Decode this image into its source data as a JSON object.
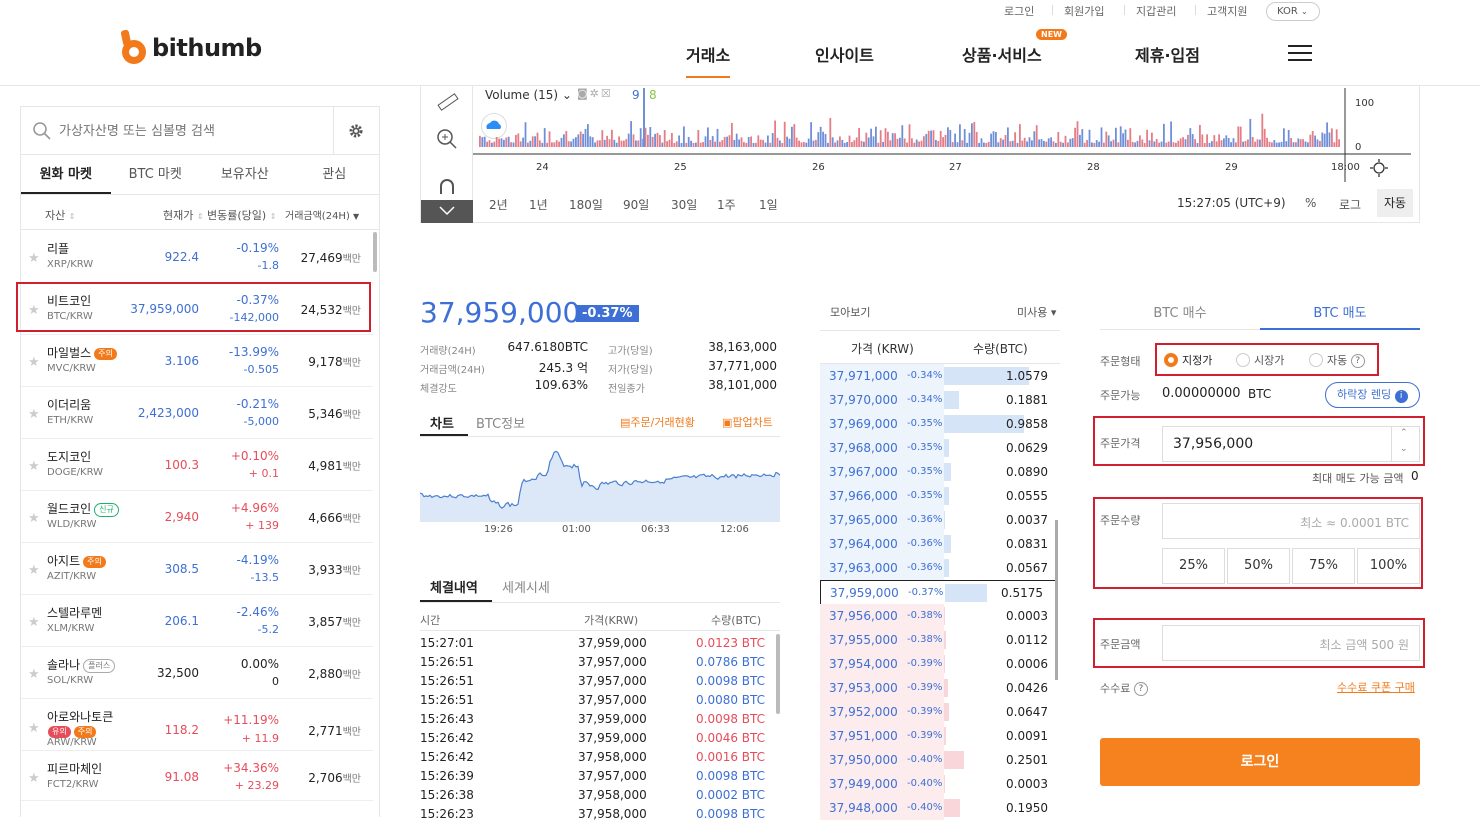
{
  "header": {
    "util_links": [
      "로그인",
      "회원가입",
      "지갑관리",
      "고객지원"
    ],
    "lang": "KOR",
    "logo_text": "bithumb",
    "nav": [
      {
        "label": "거래소",
        "active": true
      },
      {
        "label": "인사이트"
      },
      {
        "label": "상품·서비스",
        "badge": "NEW"
      },
      {
        "label": "제휴·입점"
      }
    ]
  },
  "left": {
    "search_placeholder": "가상자산명 또는 심볼명 검색",
    "tabs": [
      "원화 마켓",
      "BTC 마켓",
      "보유자산",
      "관심"
    ],
    "columns": [
      "자산",
      "현재가",
      "변동률(당일)",
      "거래금액(24H)"
    ],
    "unit": "백만",
    "coins": [
      {
        "name": "리플",
        "sym": "XRP/KRW",
        "price": "922.4",
        "chg": "-0.19%",
        "chg_abs": "-1.8",
        "vol": "27,469",
        "dir": "down"
      },
      {
        "name": "비트코인",
        "sym": "BTC/KRW",
        "price": "37,959,000",
        "chg": "-0.37%",
        "chg_abs": "-142,000",
        "vol": "24,532",
        "dir": "down"
      },
      {
        "name": "마일벌스",
        "sym": "MVC/KRW",
        "price": "3.106",
        "chg": "-13.99%",
        "chg_abs": "-0.505",
        "vol": "9,178",
        "dir": "down",
        "tags": [
          [
            "주의",
            "warn"
          ]
        ]
      },
      {
        "name": "이더리움",
        "sym": "ETH/KRW",
        "price": "2,423,000",
        "chg": "-0.21%",
        "chg_abs": "-5,000",
        "vol": "5,346",
        "dir": "down"
      },
      {
        "name": "도지코인",
        "sym": "DOGE/KRW",
        "price": "100.3",
        "chg": "+0.10%",
        "chg_abs": "+ 0.1",
        "vol": "4,981",
        "dir": "up"
      },
      {
        "name": "월드코인",
        "sym": "WLD/KRW",
        "price": "2,940",
        "chg": "+4.96%",
        "chg_abs": "+ 139",
        "vol": "4,666",
        "dir": "up",
        "tags": [
          [
            "신규",
            "new"
          ]
        ]
      },
      {
        "name": "아지트",
        "sym": "AZIT/KRW",
        "price": "308.5",
        "chg": "-4.19%",
        "chg_abs": "-13.5",
        "vol": "3,933",
        "dir": "down",
        "tags": [
          [
            "주의",
            "warn"
          ]
        ]
      },
      {
        "name": "스텔라루멘",
        "sym": "XLM/KRW",
        "price": "206.1",
        "chg": "-2.46%",
        "chg_abs": "-5.2",
        "vol": "3,857",
        "dir": "down"
      },
      {
        "name": "솔라나",
        "sym": "SOL/KRW",
        "price": "32,500",
        "chg": "0.00%",
        "chg_abs": "0",
        "vol": "2,880",
        "dir": "flat",
        "tags": [
          [
            "플러스",
            "plus"
          ]
        ]
      },
      {
        "name": "아로와나토큰",
        "sym": "ARW/KRW",
        "price": "118.2",
        "chg": "+11.19%",
        "chg_abs": "+ 11.9",
        "vol": "2,771",
        "dir": "up",
        "tags2": [
          [
            "유의",
            "red"
          ],
          [
            "주의",
            "warn"
          ]
        ]
      },
      {
        "name": "피르마체인",
        "sym": "FCT2/KRW",
        "price": "91.08",
        "chg": "+34.36%",
        "chg_abs": "+ 23.29",
        "vol": "2,706",
        "dir": "up"
      }
    ]
  },
  "chart": {
    "volume_label": "Volume (15)",
    "vol_a": "9",
    "vol_b": "8",
    "y_ticks": [
      "100",
      "0"
    ],
    "x_ticks": [
      "24",
      "25",
      "26",
      "27",
      "28",
      "29",
      "18:00"
    ],
    "periods": [
      "2년",
      "1년",
      "180일",
      "90일",
      "30일",
      "1주",
      "1일"
    ],
    "time": "15:27:05 (UTC+9)",
    "scale_opts": [
      "%",
      "로그",
      "자동"
    ]
  },
  "info": {
    "price": "37,959,000",
    "pct": "-0.37%",
    "labels_left": [
      "거래량(24H)",
      "거래금액(24H)",
      "체결강도"
    ],
    "values_left": [
      "647.6180BTC",
      "245.3 억",
      "109.63%"
    ],
    "labels_right": [
      "고가(당일)",
      "저가(당일)",
      "전일종가"
    ],
    "values_right": [
      "38,163,000",
      "37,771,000",
      "38,101,000"
    ],
    "tabs": [
      "차트",
      "BTC정보"
    ],
    "links": [
      "주문/거래현황",
      "팝업차트"
    ],
    "mini_x": [
      "19:26",
      "01:00",
      "06:33",
      "12:06"
    ]
  },
  "trades": {
    "tabs": [
      "체결내역",
      "세계시세"
    ],
    "cols": [
      "시간",
      "가격(KRW)",
      "수량(BTC)"
    ],
    "rows": [
      [
        "15:27:01",
        "37,959,000",
        "0.0123 BTC",
        "up"
      ],
      [
        "15:26:51",
        "37,957,000",
        "0.0786 BTC",
        "down"
      ],
      [
        "15:26:51",
        "37,957,000",
        "0.0098 BTC",
        "down"
      ],
      [
        "15:26:51",
        "37,957,000",
        "0.0080 BTC",
        "down"
      ],
      [
        "15:26:43",
        "37,959,000",
        "0.0098 BTC",
        "up"
      ],
      [
        "15:26:42",
        "37,959,000",
        "0.0046 BTC",
        "up"
      ],
      [
        "15:26:42",
        "37,958,000",
        "0.0016 BTC",
        "up"
      ],
      [
        "15:26:39",
        "37,957,000",
        "0.0098 BTC",
        "down"
      ],
      [
        "15:26:38",
        "37,958,000",
        "0.0002 BTC",
        "down"
      ],
      [
        "15:26:23",
        "37,958,000",
        "0.0098 BTC",
        "down"
      ]
    ]
  },
  "orderbook": {
    "view_label": "모아보기",
    "unused_label": "미사용",
    "cols": [
      "가격 (KRW)",
      "수량(BTC)"
    ],
    "asks": [
      [
        "37,971,000",
        "-0.34%",
        "1.0579",
        0.85
      ],
      [
        "37,970,000",
        "-0.34%",
        "0.1881",
        0.15
      ],
      [
        "37,969,000",
        "-0.35%",
        "0.9858",
        0.8
      ],
      [
        "37,968,000",
        "-0.35%",
        "0.0629",
        0.05
      ],
      [
        "37,967,000",
        "-0.35%",
        "0.0890",
        0.07
      ],
      [
        "37,966,000",
        "-0.35%",
        "0.0555",
        0.05
      ],
      [
        "37,965,000",
        "-0.36%",
        "0.0037",
        0.01
      ],
      [
        "37,964,000",
        "-0.36%",
        "0.0831",
        0.07
      ],
      [
        "37,963,000",
        "-0.36%",
        "0.0567",
        0.05
      ]
    ],
    "current": [
      "37,959,000",
      "-0.37%",
      "0.5175",
      0.42
    ],
    "bids": [
      [
        "37,956,000",
        "-0.38%",
        "0.0003",
        0.01
      ],
      [
        "37,955,000",
        "-0.38%",
        "0.0112",
        0.02
      ],
      [
        "37,954,000",
        "-0.39%",
        "0.0006",
        0.01
      ],
      [
        "37,953,000",
        "-0.39%",
        "0.0426",
        0.04
      ],
      [
        "37,952,000",
        "-0.39%",
        "0.0647",
        0.05
      ],
      [
        "37,951,000",
        "-0.39%",
        "0.0091",
        0.02
      ],
      [
        "37,950,000",
        "-0.40%",
        "0.2501",
        0.2
      ],
      [
        "37,949,000",
        "-0.40%",
        "0.0003",
        0.01
      ],
      [
        "37,948,000",
        "-0.40%",
        "0.1950",
        0.16
      ]
    ]
  },
  "order": {
    "tabs": [
      "BTC 매수",
      "BTC 매도"
    ],
    "type_label": "주문형태",
    "types": [
      "지정가",
      "시장가",
      "자동"
    ],
    "avail_label": "주문가능",
    "avail_value": "0.00000000",
    "avail_unit": "BTC",
    "lending_btn": "하락장 렌딩",
    "price_label": "주문가격",
    "price_value": "37,956,000",
    "max_label": "최대 매도 가능 금액",
    "max_value": "0",
    "qty_label": "주문수량",
    "qty_placeholder": "최소 ≈ 0.0001 BTC",
    "pcts": [
      "25%",
      "50%",
      "75%",
      "100%"
    ],
    "amount_label": "주문금액",
    "amount_placeholder": "최소 금액 500 원",
    "fee_label": "수수료",
    "coupon_link": "수수료 쿠폰 구매",
    "login_btn": "로그인"
  }
}
